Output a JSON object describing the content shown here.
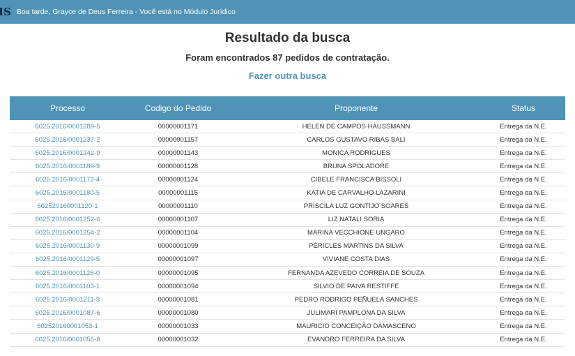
{
  "topbar": {
    "logo": "IS",
    "greeting": "Boa tarde, Grayce de Deus Ferreira - Você está no Módulo Jurídico"
  },
  "main": {
    "title": "Resultado da busca",
    "subtitle": "Foram encontrados 87 pedidos de contratação.",
    "search_again_link": "Fazer outra busca"
  },
  "table": {
    "headers": [
      "Processo",
      "Codigo do Pedido",
      "Proponente",
      "Status"
    ],
    "rows": [
      {
        "processo": "6025.2016/0001289-5",
        "codigo": "00000001171",
        "proponente": "HELEN DE CAMPOS HAUSSMANN",
        "status": "Entrega da N.E."
      },
      {
        "processo": "6025.2016/0001237-2",
        "codigo": "00000001157",
        "proponente": "CARLOS GUSTAVO RIBAS BALI",
        "status": "Entrega da N.E."
      },
      {
        "processo": "6025.2016/0001242-9",
        "codigo": "00000001143",
        "proponente": "MONICA RODRIGUES",
        "status": "Entrega da N.E."
      },
      {
        "processo": "6025.2016/0001189-9",
        "codigo": "00000001128",
        "proponente": "BRUNA SPOLADORE",
        "status": "Entrega da N.E."
      },
      {
        "processo": "6025.2016/0001172-4",
        "codigo": "00000001124",
        "proponente": "CIBELE FRANCISCA BISSOLI",
        "status": "Entrega da N.E."
      },
      {
        "processo": "6025.2016/0001180-5",
        "codigo": "00000001115",
        "proponente": "KATIA DE CARVALHO LAZARINI",
        "status": "Entrega da N.E."
      },
      {
        "processo": "602520160001120-1",
        "codigo": "00000001110",
        "proponente": "PRISCILA LUZ GONTIJO SOARES",
        "status": "Entrega da N.E."
      },
      {
        "processo": "6025.2016/0001252-6",
        "codigo": "00000001107",
        "proponente": "LIZ NATALI SORIA",
        "status": "Entrega da N.E."
      },
      {
        "processo": "6025.2016/0001254-2",
        "codigo": "00000001104",
        "proponente": "MARINA VECCHIONE UNGARO",
        "status": "Entrega da N.E."
      },
      {
        "processo": "6025.2016/0001130-9",
        "codigo": "00000001099",
        "proponente": "PÉRICLES MARTINS DA SILVA",
        "status": "Entrega da N.E."
      },
      {
        "processo": "6025.2016/0001129-5",
        "codigo": "00000001097",
        "proponente": "VIVIANE COSTA DIAS",
        "status": "Entrega da N.E."
      },
      {
        "processo": "6025.2016/0001126-0",
        "codigo": "00000001095",
        "proponente": "FERNANDA AZEVEDO CORREIA DE SOUZA",
        "status": "Entrega da N.E."
      },
      {
        "processo": "6025.2016/0001103-1",
        "codigo": "00000001094",
        "proponente": "SILVIO DE PAIVA RESTIFFE",
        "status": "Entrega da N.E."
      },
      {
        "processo": "6025.2016/0001211-9",
        "codigo": "00000001081",
        "proponente": "PEDRO RODRIGO PEÑUELA SANCHES",
        "status": "Entrega da N.E."
      },
      {
        "processo": "6025.2016/0001087-6",
        "codigo": "00000001080",
        "proponente": "JULIMARI PAMPLONA DA SILVA",
        "status": "Entrega da N.E."
      },
      {
        "processo": "602520160001053-1",
        "codigo": "00000001033",
        "proponente": "MAURICIO CONCEIÇÃO DAMASCENO",
        "status": "Entrega da N.E."
      },
      {
        "processo": "6025.2016/0001055-8",
        "codigo": "00000001032",
        "proponente": "EVANDRO FERREIRA DA SILVA",
        "status": "Entrega da N.E."
      }
    ]
  },
  "colors": {
    "accent": "#4f93b7",
    "logo": "#0b2a44"
  }
}
